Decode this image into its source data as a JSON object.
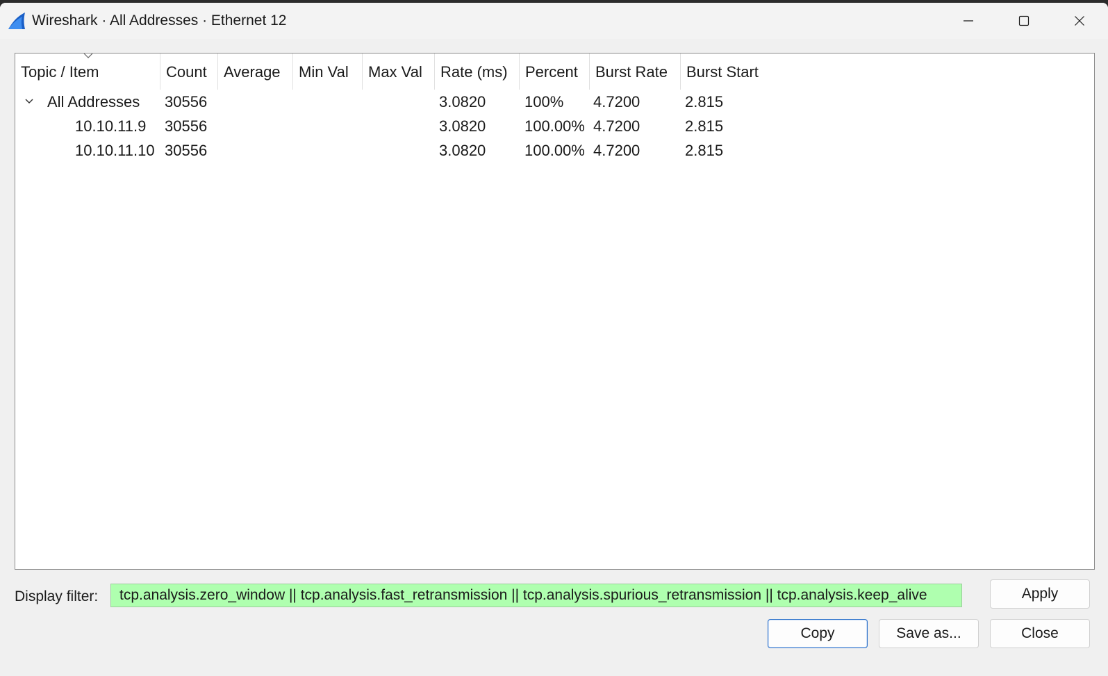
{
  "window": {
    "title": "Wireshark · All Addresses · Ethernet 12",
    "controls": {
      "minimize_icon": "minimize-icon",
      "maximize_icon": "maximize-icon",
      "close_icon": "close-icon"
    }
  },
  "table": {
    "sort_column": "Topic / Item",
    "columns": [
      "Topic / Item",
      "Count",
      "Average",
      "Min Val",
      "Max Val",
      "Rate (ms)",
      "Percent",
      "Burst Rate",
      "Burst Start"
    ],
    "rows": [
      {
        "expanded": true,
        "topic": "All Addresses",
        "count": "30556",
        "average": "",
        "min_val": "",
        "max_val": "",
        "rate": "3.0820",
        "percent": "100%",
        "burst_rate": "4.7200",
        "burst_start": "2.815"
      },
      {
        "topic": "10.10.11.9",
        "count": "30556",
        "average": "",
        "min_val": "",
        "max_val": "",
        "rate": "3.0820",
        "percent": "100.00%",
        "burst_rate": "4.7200",
        "burst_start": "2.815"
      },
      {
        "topic": "10.10.11.10",
        "count": "30556",
        "average": "",
        "min_val": "",
        "max_val": "",
        "rate": "3.0820",
        "percent": "100.00%",
        "burst_rate": "4.7200",
        "burst_start": "2.815"
      }
    ]
  },
  "filter": {
    "label": "Display filter:",
    "value": "tcp.analysis.zero_window || tcp.analysis.fast_retransmission || tcp.analysis.spurious_retransmission || tcp.analysis.keep_alive",
    "valid_color": "#afffaf"
  },
  "buttons": {
    "apply": "Apply",
    "copy": "Copy",
    "save_as": "Save as...",
    "close": "Close"
  },
  "colors": {
    "accent": "#2a6fc9",
    "window_bg": "#f0f0f0"
  }
}
